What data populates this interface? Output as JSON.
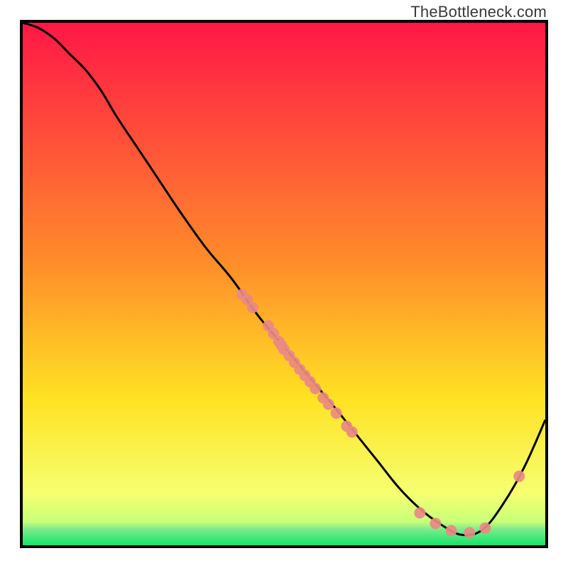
{
  "watermark": "TheBottleneck.com",
  "colors": {
    "gradient_top": "#ff1747",
    "gradient_mid1": "#ff8a2b",
    "gradient_mid2": "#ffe223",
    "gradient_low": "#f6ff70",
    "gradient_green": "#10e66a",
    "line": "#000000",
    "dot": "#e56a6a",
    "dot_fill": "#e98a82",
    "border": "#000000"
  },
  "chart_data": {
    "type": "line",
    "title": "",
    "xlabel": "",
    "ylabel": "",
    "xlim": [
      0,
      100
    ],
    "ylim": [
      0,
      100
    ],
    "grid": false,
    "legend": false,
    "series": [
      {
        "name": "bottleneck-curve",
        "x": [
          0,
          3,
          6,
          9,
          12,
          15,
          18,
          22,
          26,
          30,
          35,
          40,
          45,
          50,
          55,
          60,
          64,
          68,
          72,
          76,
          80,
          84,
          88,
          92,
          96,
          100
        ],
        "y": [
          100,
          99,
          97,
          94,
          91,
          87,
          82,
          76,
          70,
          64,
          57,
          51,
          44,
          38,
          32,
          26,
          21,
          16,
          11,
          7,
          4,
          2,
          3,
          8,
          15,
          24
        ]
      }
    ],
    "scatter_clusters": [
      {
        "name": "cluster-upper",
        "points": [
          {
            "x": 42,
            "y": 48
          },
          {
            "x": 43,
            "y": 47
          },
          {
            "x": 44,
            "y": 45.5
          },
          {
            "x": 47,
            "y": 42
          },
          {
            "x": 48,
            "y": 40.5
          },
          {
            "x": 49,
            "y": 39
          },
          {
            "x": 49.5,
            "y": 38.3
          },
          {
            "x": 50,
            "y": 37.5
          },
          {
            "x": 51,
            "y": 36.3
          },
          {
            "x": 52,
            "y": 35
          },
          {
            "x": 53,
            "y": 33.7
          },
          {
            "x": 54,
            "y": 32.5
          },
          {
            "x": 55,
            "y": 31.3
          },
          {
            "x": 56,
            "y": 30
          },
          {
            "x": 57.5,
            "y": 28.2
          },
          {
            "x": 58.5,
            "y": 27
          },
          {
            "x": 60,
            "y": 25.3
          },
          {
            "x": 62,
            "y": 22.8
          },
          {
            "x": 63,
            "y": 21.7
          }
        ]
      },
      {
        "name": "cluster-valley",
        "points": [
          {
            "x": 76,
            "y": 6.2
          },
          {
            "x": 79,
            "y": 4.2
          },
          {
            "x": 82,
            "y": 2.8
          },
          {
            "x": 85.5,
            "y": 2.4
          },
          {
            "x": 88.5,
            "y": 3.3
          }
        ]
      },
      {
        "name": "cluster-right",
        "points": [
          {
            "x": 95,
            "y": 13.2
          }
        ]
      }
    ]
  }
}
